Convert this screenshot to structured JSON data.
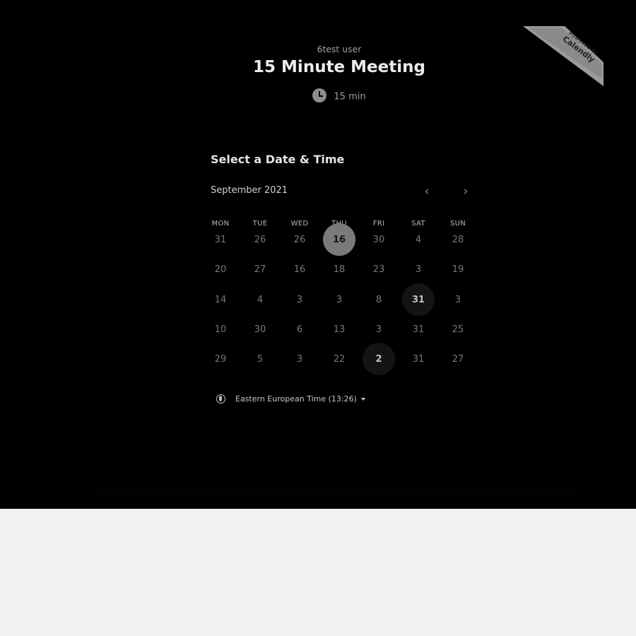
{
  "event": {
    "owner": "6test user",
    "title": "15 Minute Meeting",
    "duration": "15 min"
  },
  "scheduler": {
    "heading": "Select a Date & Time",
    "month": "September 2021",
    "prev_icon": "‹",
    "next_icon": "›",
    "weekdays": [
      "MON",
      "TUE",
      "WED",
      "THU",
      "FRI",
      "SAT",
      "SUN"
    ],
    "weeks": [
      [
        "31",
        "26",
        "26",
        "16",
        "30",
        "4",
        "28"
      ],
      [
        "20",
        "27",
        "16",
        "18",
        "23",
        "3",
        "19"
      ],
      [
        "14",
        "4",
        "3",
        "3",
        "8",
        "31",
        "3"
      ],
      [
        "10",
        "30",
        "6",
        "13",
        "3",
        "31",
        "25"
      ],
      [
        "29",
        "5",
        "3",
        "22",
        "2",
        "31",
        "27"
      ]
    ]
  },
  "timezone": {
    "label": "Eastern European Time (13:26)"
  },
  "badge": {
    "top_text": "POWERED BY",
    "brand": "Calendly"
  }
}
